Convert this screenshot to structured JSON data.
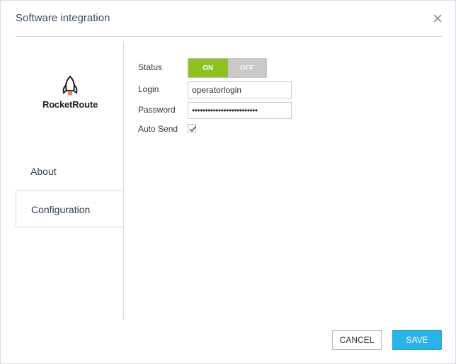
{
  "dialog": {
    "title": "Software integration",
    "close_icon": "close-icon"
  },
  "sidebar": {
    "logo_text": "RocketRoute",
    "logo_icon": "rocket-icon",
    "tabs": [
      {
        "label": "About",
        "active": false
      },
      {
        "label": "Configuration",
        "active": true
      }
    ]
  },
  "form": {
    "status_label": "Status",
    "status_on": "ON",
    "status_off": "OFF",
    "status_value": "ON",
    "login_label": "Login",
    "login_value": "operatorlogin",
    "password_label": "Password",
    "password_value": "•••••••••••••••••••••••••",
    "autosend_label": "Auto Send",
    "autosend_checked": true
  },
  "footer": {
    "cancel_label": "CANCEL",
    "save_label": "SAVE"
  },
  "colors": {
    "toggle_on": "#8dc21f",
    "toggle_off": "#c9c9c9",
    "save_button": "#2bb3e8",
    "logo_accent": "#e8632b"
  }
}
